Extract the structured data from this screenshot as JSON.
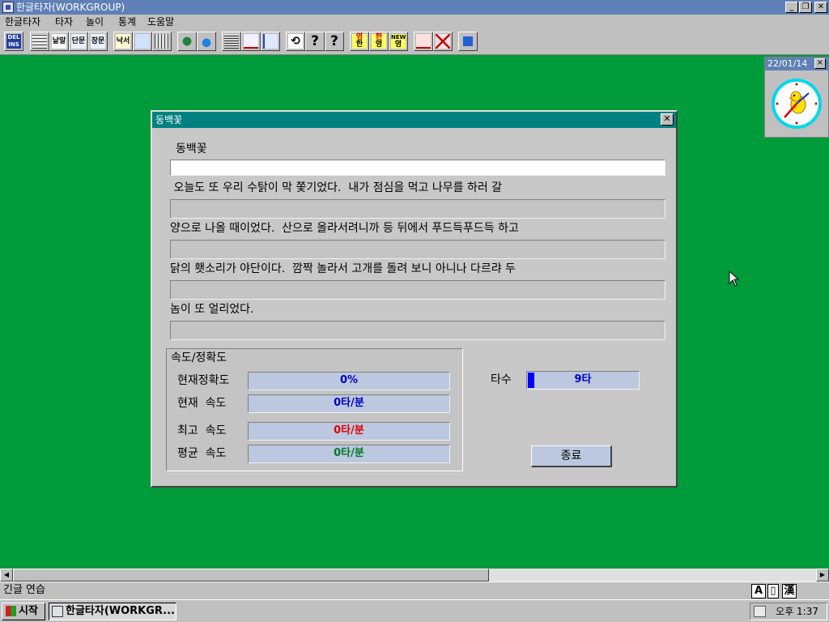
{
  "window": {
    "title": "한글타자(WORKGROUP)"
  },
  "menu": [
    "한글타자",
    "타자",
    "놀이",
    "통계",
    "도움말"
  ],
  "toolbar": {
    "del_ins": "DEL INS",
    "btn_naml": "낱말",
    "btn_danmun": "단문",
    "btn_jangmun": "장문",
    "btn_naksu": "낙서",
    "btn_q1": "?",
    "btn_q2": "?",
    "btn_yeong": "영",
    "btn_han": "한",
    "btn_han2": "한",
    "btn_yeong2": "영",
    "btn_new": "NEW",
    "btn_yeong3": "영"
  },
  "clock": {
    "date": "22/01/14",
    "close": "×"
  },
  "dialog": {
    "title": "동백꽃",
    "lesson_title": "동백꽃",
    "lines": [
      " 오늘도 또 우리 수탉이 막 쫓기었다.  내가 점심을 먹고 나무를 하러 갈",
      "양으로 나올 때이었다.  산으로 올라서려니까 등 뒤에서 푸드득푸드득 하고",
      "닭의 횃소리가 야단이다.  깜짝 놀라서 고개를 돌려 보니 아니나 다르랴 두",
      "놈이 또 얼리었다."
    ],
    "stats": {
      "header": "속도/정확도",
      "current_accuracy_label": "현재정확도",
      "current_accuracy": "0%",
      "current_speed_label": "현재  속도",
      "current_speed": "0타/분",
      "max_speed_label": "최고  속도",
      "max_speed": "0타/분",
      "avg_speed_label": "평균  속도",
      "avg_speed": "0타/분"
    },
    "keycount_label": "타수",
    "keycount_value": "9타",
    "end_button": "종료"
  },
  "colors": {
    "desktop": "#009b3a",
    "titlebar": "#5f80b6",
    "dialog_title": "#008080",
    "current_values": "#0000c0",
    "max_speed": "#e00000",
    "avg_speed": "#007a2a"
  },
  "status": {
    "message": "긴글 연습",
    "ime_a": "A",
    "ime_b": "漢"
  },
  "taskbar": {
    "start": "시작",
    "task": "한글타자(WORKGR...",
    "time": "오후 1:37"
  }
}
